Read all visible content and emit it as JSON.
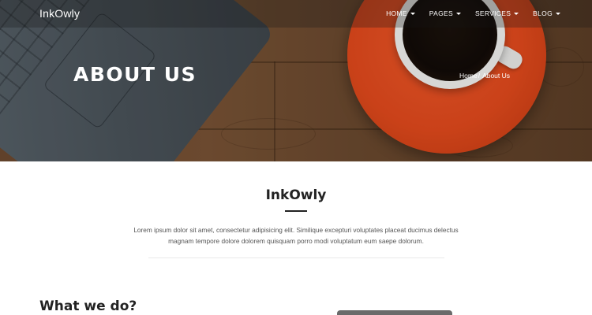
{
  "navbar": {
    "brand": "InkOwly",
    "items": [
      {
        "label": "HOME",
        "has_dropdown": true
      },
      {
        "label": "PAGES",
        "has_dropdown": true
      },
      {
        "label": "SERVICES",
        "has_dropdown": true
      },
      {
        "label": "BLOG",
        "has_dropdown": true
      }
    ]
  },
  "hero": {
    "title": "ABOUT US",
    "breadcrumb": {
      "home": "Home",
      "separator": "/",
      "current": "About Us"
    }
  },
  "intro": {
    "title": "InkOwly",
    "text": "Lorem ipsum dolor sit amet, consectetur adipisicing elit. Similique excepturi voluptates placeat ducimus delectus magnam tempore dolore dolorem quisquam porro modi voluptatum eum saepe dolorum."
  },
  "what_we_do": {
    "title": "What we do?"
  },
  "colors": {
    "accent": "#e64b1d",
    "text_dark": "#222222",
    "text_muted": "#555555"
  }
}
